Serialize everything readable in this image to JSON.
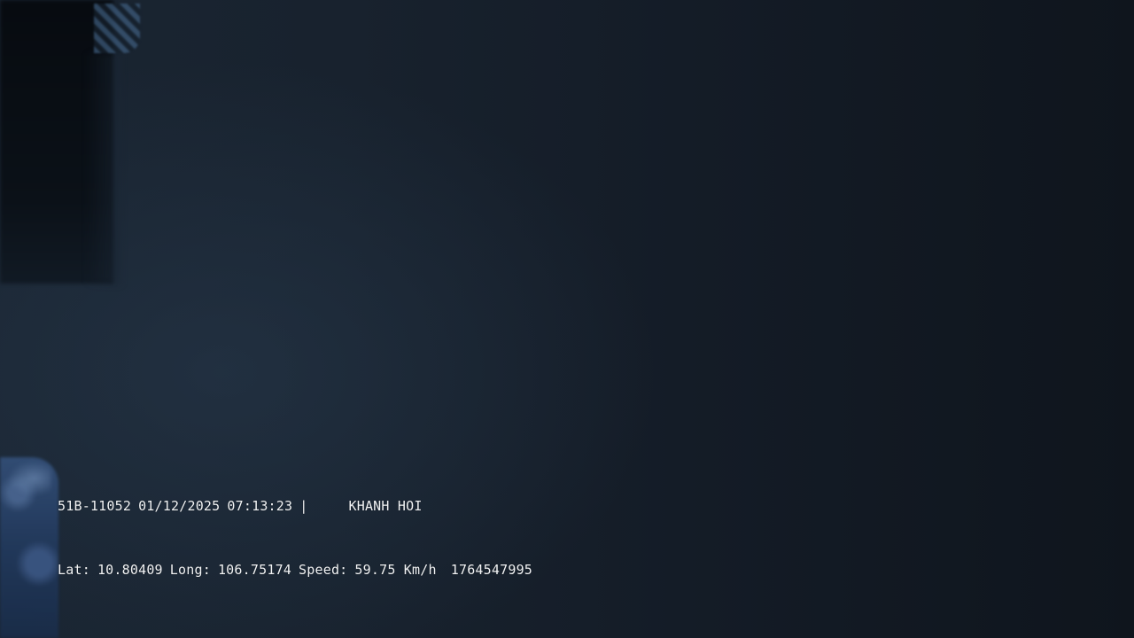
{
  "osd": {
    "plate": "51B-11052",
    "date": "01/12/2025",
    "time": "07:13:23",
    "separator": "|",
    "location": "KHANH HOI",
    "lat_label": "Lat:",
    "lat": "10.80409",
    "long_label": "Long:",
    "long": "106.75174",
    "speed_label": "Speed:",
    "speed": "59.75 Km/h",
    "timestamp": "1764547995"
  },
  "colors": {
    "osd_text": "#f2f4f6",
    "background": "#141c26",
    "object_blue": "#34507a"
  }
}
